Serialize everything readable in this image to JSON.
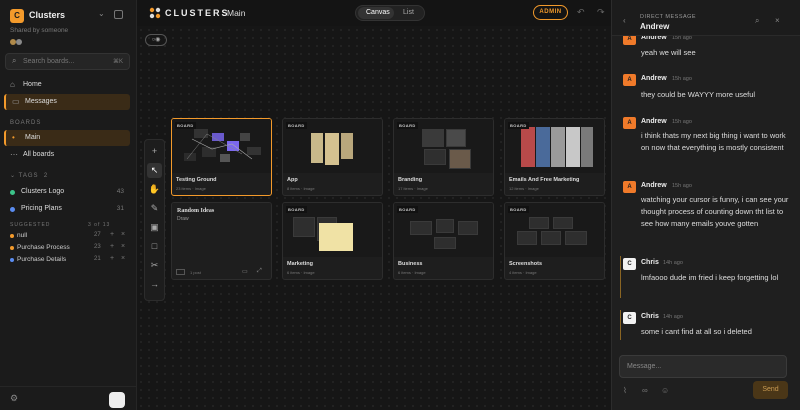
{
  "sidebar": {
    "workspace_initial": "C",
    "workspace_name": "Clusters",
    "shared_text": "Shared by someone",
    "search_placeholder": "Search boards...",
    "search_shortcut": "⌘K",
    "nav": [
      {
        "label": "Home"
      },
      {
        "label": "Messages"
      }
    ],
    "boards_header": "BOARDS",
    "boards": [
      {
        "label": "Main"
      },
      {
        "label": "All boards"
      }
    ],
    "tags_header": "TAGS",
    "tags_count": "2",
    "tags": [
      {
        "label": "Clusters Logo",
        "count": "43",
        "color": "#3cc48a"
      },
      {
        "label": "Pricing Plans",
        "count": "31",
        "color": "#5a8cf0"
      }
    ],
    "suggested_header": "SUGGESTED",
    "suggested_page": "3 of 13",
    "suggested": [
      {
        "label": "null",
        "count": "27",
        "color": "#f39a2b"
      },
      {
        "label": "Purchase Process",
        "count": "23",
        "color": "#f39a2b"
      },
      {
        "label": "Purchase Details",
        "count": "21",
        "color": "#5a8cf0"
      }
    ]
  },
  "topbar": {
    "brand": "CLUSTERS",
    "crumb": "Main",
    "view_options": [
      "Canvas",
      "List"
    ],
    "role_badge": "ADMIN"
  },
  "boards": [
    {
      "badge": "BOARD",
      "title": "Testing Ground",
      "meta": "23 items · Image",
      "selected": true
    },
    {
      "badge": "BOARD",
      "title": "App",
      "meta": "8 items · Image"
    },
    {
      "badge": "BOARD",
      "title": "Branding",
      "meta": "17 items · Image"
    },
    {
      "badge": "BOARD",
      "title": "Emails And Free Marketing",
      "meta": "12 items · Image"
    },
    {
      "badge": "",
      "title": "Random Ideas",
      "subtitle": "Draw",
      "meta": "1 post"
    },
    {
      "badge": "BOARD",
      "title": "Marketing",
      "meta": "6 items · Image"
    },
    {
      "badge": "BOARD",
      "title": "Business",
      "meta": "6 items · Image"
    },
    {
      "badge": "BOARD",
      "title": "Screenshots",
      "meta": "4 items · Image"
    }
  ],
  "chat": {
    "kind": "DIRECT MESSAGE",
    "name": "Andrew",
    "messages": [
      {
        "author": "Andrew",
        "initial": "A",
        "time": "15h ago",
        "text": "yeah we will see"
      },
      {
        "author": "Andrew",
        "initial": "A",
        "time": "15h ago",
        "text": "they could be WAYYY more useful"
      },
      {
        "author": "Andrew",
        "initial": "A",
        "time": "15h ago",
        "text": "i think thats my next big thing i want to work on now that everything is mostly consistent"
      },
      {
        "author": "Andrew",
        "initial": "A",
        "time": "15h ago",
        "text": "watching your cursor is funny, i can see your thought process of counting down tht list to see how many emails youve gotten"
      },
      {
        "author": "Chris",
        "initial": "C",
        "time": "14h ago",
        "text": "lmfaooo dude im fried i keep forgetting lol"
      },
      {
        "author": "Chris",
        "initial": "C",
        "time": "14h ago",
        "text": "some i cant find at all so i deleted"
      }
    ],
    "composer_placeholder": "Message...",
    "send_label": "Send"
  },
  "colors": {
    "accent": "#f39a2b",
    "andrew_avatar": "#f07a2a",
    "chris_avatar": "#f2f2f2"
  }
}
